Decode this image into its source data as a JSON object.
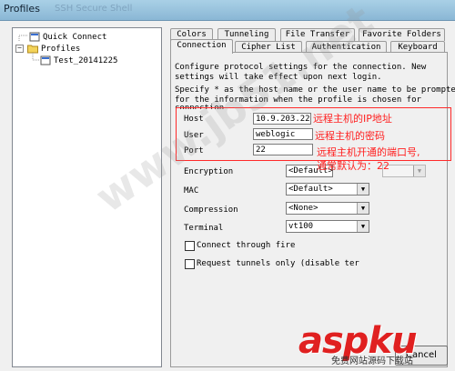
{
  "window": {
    "title": "Profiles",
    "ghost_title": "SSH Secure Shell"
  },
  "tree": {
    "items": [
      {
        "label": "Quick Connect"
      },
      {
        "label": "Profiles"
      },
      {
        "label": "Test_20141225"
      }
    ]
  },
  "tabs": {
    "top_row": [
      "Colors",
      "Tunneling",
      "File Transfer",
      "Favorite Folders"
    ],
    "bottom_row": [
      "Connection",
      "Cipher List",
      "Authentication",
      "Keyboard"
    ],
    "active": "Connection"
  },
  "connection": {
    "intro_1": "Configure protocol settings for the connection. New",
    "intro_2": "settings will take effect upon next login.",
    "specify_1": "Specify * as the host name or the user name to be prompted",
    "specify_2": "for the information when the profile is chosen for",
    "specify_3": "connection",
    "host_label": "Host",
    "host_value": "10.9.203.228",
    "user_label": "User",
    "user_value": "weblogic",
    "port_label": "Port",
    "port_value": "22",
    "encryption_label": "Encryption",
    "encryption_value": "<Default>",
    "mac_label": "MAC",
    "mac_value": "<Default>",
    "compression_label": "Compression",
    "compression_value": "<None>",
    "terminal_label": "Terminal",
    "terminal_value": "vt100",
    "connect_fire_label": "Connect through fire",
    "request_tunnels_label": "Request tunnels only (disable ter"
  },
  "annotations": {
    "host_note": "远程主机的IP地址",
    "user_note": "远程主机的密码",
    "port_note_1": "远程主机开通的端口号,",
    "port_note_2": "通常默认为：22"
  },
  "watermark": {
    "text": "www.jb51.net"
  },
  "logo": {
    "main": "aspku",
    "sub": "免费网站源码下载站"
  },
  "buttons": {
    "cancel": "Cancel"
  },
  "colors": {
    "annotation_red": "#ff2020",
    "logo_red": "#e02020"
  }
}
